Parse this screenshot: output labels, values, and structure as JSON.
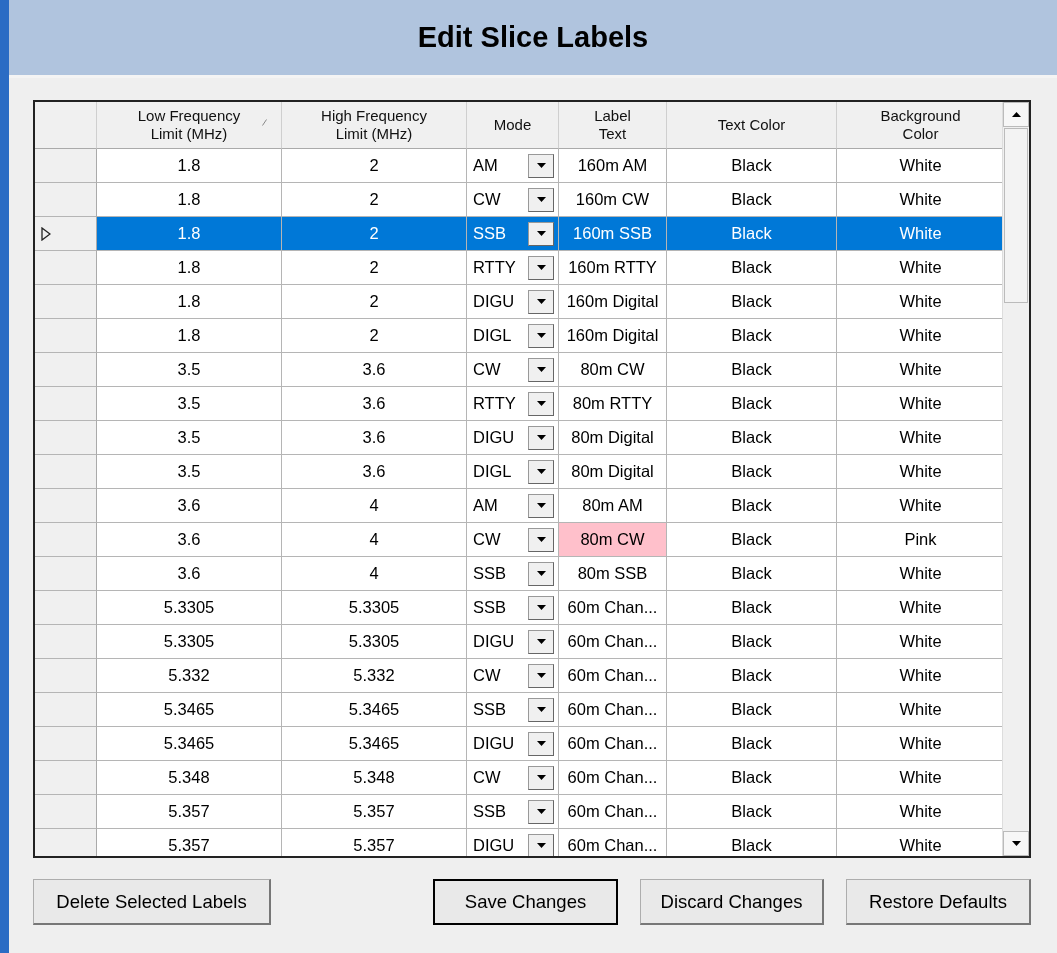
{
  "title": "Edit Slice Labels",
  "table": {
    "columns": [
      {
        "label": "Low Frequency Limit (MHz)",
        "sorted": true
      },
      {
        "label": "High Frequency Limit (MHz)",
        "sorted": false
      },
      {
        "label": "Mode",
        "sorted": false
      },
      {
        "label": "Label Text",
        "sorted": false
      },
      {
        "label": "Text Color",
        "sorted": false
      },
      {
        "label": "Background Color",
        "sorted": false
      }
    ],
    "rows": [
      {
        "low": "1.8",
        "high": "2",
        "mode": "AM",
        "label": "160m AM",
        "text_color": "Black",
        "background": "White",
        "selected": false
      },
      {
        "low": "1.8",
        "high": "2",
        "mode": "CW",
        "label": "160m CW",
        "text_color": "Black",
        "background": "White",
        "selected": false
      },
      {
        "low": "1.8",
        "high": "2",
        "mode": "SSB",
        "label": "160m SSB",
        "text_color": "Black",
        "background": "White",
        "selected": true
      },
      {
        "low": "1.8",
        "high": "2",
        "mode": "RTTY",
        "label": "160m RTTY",
        "text_color": "Black",
        "background": "White",
        "selected": false
      },
      {
        "low": "1.8",
        "high": "2",
        "mode": "DIGU",
        "label": "160m Digital",
        "text_color": "Black",
        "background": "White",
        "selected": false
      },
      {
        "low": "1.8",
        "high": "2",
        "mode": "DIGL",
        "label": "160m Digital",
        "text_color": "Black",
        "background": "White",
        "selected": false
      },
      {
        "low": "3.5",
        "high": "3.6",
        "mode": "CW",
        "label": "80m CW",
        "text_color": "Black",
        "background": "White",
        "selected": false
      },
      {
        "low": "3.5",
        "high": "3.6",
        "mode": "RTTY",
        "label": "80m RTTY",
        "text_color": "Black",
        "background": "White",
        "selected": false
      },
      {
        "low": "3.5",
        "high": "3.6",
        "mode": "DIGU",
        "label": "80m Digital",
        "text_color": "Black",
        "background": "White",
        "selected": false
      },
      {
        "low": "3.5",
        "high": "3.6",
        "mode": "DIGL",
        "label": "80m Digital",
        "text_color": "Black",
        "background": "White",
        "selected": false
      },
      {
        "low": "3.6",
        "high": "4",
        "mode": "AM",
        "label": "80m AM",
        "text_color": "Black",
        "background": "White",
        "selected": false
      },
      {
        "low": "3.6",
        "high": "4",
        "mode": "CW",
        "label": "80m CW",
        "text_color": "Black",
        "background": "Pink",
        "color": "#ffc0cb",
        "selected": false
      },
      {
        "low": "3.6",
        "high": "4",
        "mode": "SSB",
        "label": "80m SSB",
        "text_color": "Black",
        "background": "White",
        "selected": false
      },
      {
        "low": "5.3305",
        "high": "5.3305",
        "mode": "SSB",
        "label": "60m Chan...",
        "text_color": "Black",
        "background": "White",
        "selected": false
      },
      {
        "low": "5.3305",
        "high": "5.3305",
        "mode": "DIGU",
        "label": "60m Chan...",
        "text_color": "Black",
        "background": "White",
        "selected": false
      },
      {
        "low": "5.332",
        "high": "5.332",
        "mode": "CW",
        "label": "60m Chan...",
        "text_color": "Black",
        "background": "White",
        "selected": false
      },
      {
        "low": "5.3465",
        "high": "5.3465",
        "mode": "SSB",
        "label": "60m Chan...",
        "text_color": "Black",
        "background": "White",
        "selected": false
      },
      {
        "low": "5.3465",
        "high": "5.3465",
        "mode": "DIGU",
        "label": "60m Chan...",
        "text_color": "Black",
        "background": "White",
        "selected": false
      },
      {
        "low": "5.348",
        "high": "5.348",
        "mode": "CW",
        "label": "60m Chan...",
        "text_color": "Black",
        "background": "White",
        "selected": false
      },
      {
        "low": "5.357",
        "high": "5.357",
        "mode": "SSB",
        "label": "60m Chan...",
        "text_color": "Black",
        "background": "White",
        "selected": false
      },
      {
        "low": "5.357",
        "high": "5.357",
        "mode": "DIGU",
        "label": "60m Chan...",
        "text_color": "Black",
        "background": "White",
        "selected": false
      }
    ]
  },
  "buttons": [
    {
      "label": "Delete Selected Labels",
      "default": false
    },
    {
      "label": "Save Changes",
      "default": true
    },
    {
      "label": "Discard Changes",
      "default": false
    },
    {
      "label": "Restore Defaults",
      "default": false
    }
  ]
}
